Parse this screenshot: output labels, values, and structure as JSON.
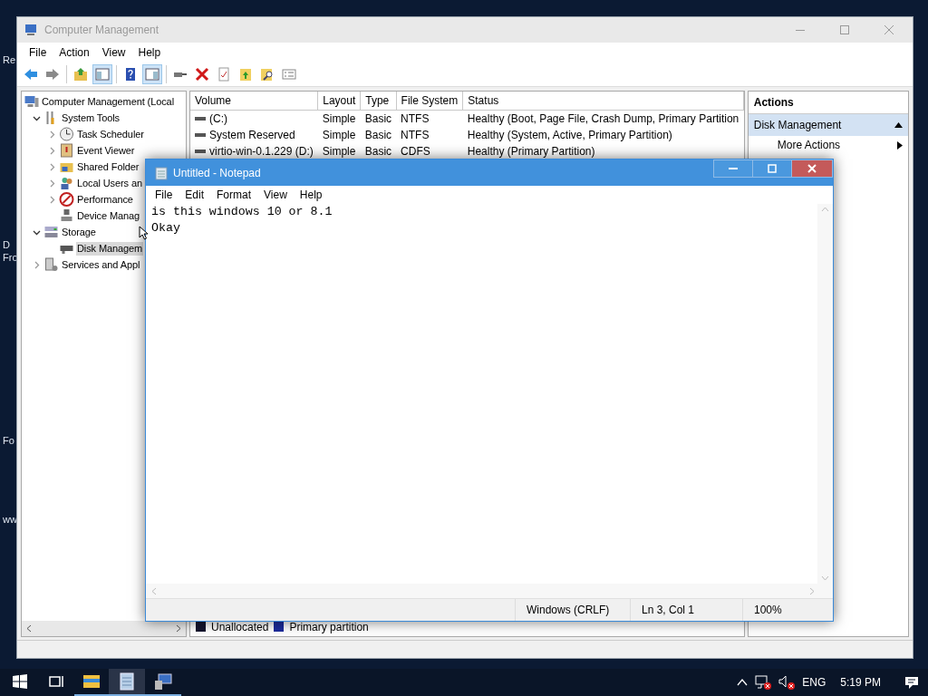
{
  "desktop": {
    "icon_labels": [
      "Re",
      "D",
      "Fro",
      "Fo",
      "ww"
    ]
  },
  "computer_management": {
    "title": "Computer Management",
    "active": false,
    "menu": [
      "File",
      "Action",
      "View",
      "Help"
    ],
    "toolbar": [
      {
        "kind": "back",
        "pressed": false
      },
      {
        "kind": "forward",
        "pressed": false
      },
      {
        "kind": "sep"
      },
      {
        "kind": "up",
        "pressed": false
      },
      {
        "kind": "tree",
        "pressed": true
      },
      {
        "kind": "sep"
      },
      {
        "kind": "help",
        "pressed": false
      },
      {
        "kind": "actionpane",
        "pressed": true
      },
      {
        "kind": "sep"
      },
      {
        "kind": "connect",
        "pressed": false
      },
      {
        "kind": "delete",
        "pressed": false
      },
      {
        "kind": "properties",
        "pressed": false
      },
      {
        "kind": "export",
        "pressed": false
      },
      {
        "kind": "find",
        "pressed": false
      },
      {
        "kind": "list",
        "pressed": false
      }
    ],
    "tree": [
      {
        "label": "Computer Management (Local",
        "kind": "computer",
        "selected": false,
        "children": [
          {
            "label": "System Tools",
            "kind": "tools",
            "expanded": true,
            "selected": false,
            "children": [
              {
                "label": "Task Scheduler",
                "kind": "clock",
                "expanded": false,
                "selected": false
              },
              {
                "label": "Event Viewer",
                "kind": "log",
                "expanded": false,
                "selected": false
              },
              {
                "label": "Shared Folder",
                "kind": "folder",
                "expanded": false,
                "selected": false
              },
              {
                "label": "Local Users an",
                "kind": "users",
                "expanded": false,
                "selected": false
              },
              {
                "label": "Performance",
                "kind": "gauge",
                "expanded": false,
                "selected": false
              },
              {
                "label": "Device Manag",
                "kind": "device",
                "selected": false
              }
            ]
          },
          {
            "label": "Storage",
            "kind": "storage",
            "expanded": true,
            "selected": false,
            "children": [
              {
                "label": "Disk Managem",
                "kind": "disk",
                "selected": true
              }
            ]
          },
          {
            "label": "Services and Appl",
            "kind": "services",
            "expanded": false,
            "selected": false
          }
        ]
      }
    ],
    "volumes": {
      "columns": [
        "Volume",
        "Layout",
        "Type",
        "File System",
        "Status"
      ],
      "rows": [
        {
          "cells": [
            "(C:)",
            "Simple",
            "Basic",
            "NTFS",
            "Healthy (Boot, Page File, Crash Dump, Primary Partition"
          ]
        },
        {
          "cells": [
            "System Reserved",
            "Simple",
            "Basic",
            "NTFS",
            "Healthy (System, Active, Primary Partition)"
          ]
        },
        {
          "cells": [
            "virtio-win-0.1.229 (D:)",
            "Simple",
            "Basic",
            "CDFS",
            "Healthy (Primary Partition)"
          ]
        }
      ]
    },
    "legend": [
      {
        "label": "Unallocated",
        "color": "#14142e"
      },
      {
        "label": "Primary partition",
        "color": "#1c2c9c"
      }
    ],
    "actions": {
      "title": "Actions",
      "section": {
        "label": "Disk Management",
        "expanded": true
      },
      "items": [
        {
          "label": "More Actions"
        }
      ]
    }
  },
  "notepad": {
    "title": "Untitled - Notepad",
    "active": true,
    "menu": [
      "File",
      "Edit",
      "Format",
      "View",
      "Help"
    ],
    "text_lines": [
      "is this windows 10 or 8.1",
      "Okay"
    ],
    "status": [
      "Windows (CRLF)",
      "Ln 3, Col 1",
      "100%"
    ]
  },
  "taskbar": {
    "apps": [
      {
        "kind": "explorer",
        "active": false
      },
      {
        "kind": "notepad",
        "active": true
      },
      {
        "kind": "computer",
        "active": false
      }
    ],
    "language": "ENG",
    "time": "5:19 PM"
  }
}
